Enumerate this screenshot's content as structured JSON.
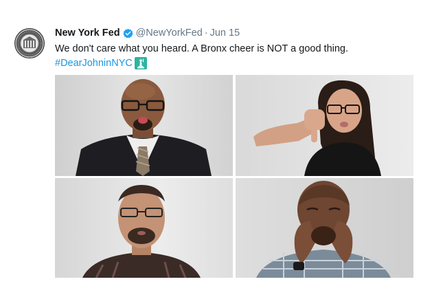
{
  "tweet": {
    "display_name": "New York Fed",
    "handle": "@NewYorkFed",
    "separator": "·",
    "date": "Jun 15",
    "text": "We don't care what you heard. A Bronx cheer is NOT a good thing.",
    "hashtag": "#DearJohninNYC",
    "hashtag_emoji": "statue-of-liberty-emoji",
    "avatar": "federal-reserve-seal-icon",
    "verified": "verified-badge-icon"
  },
  "media": {
    "photos": [
      {
        "alt": "man in suit and glasses sticking out tongue"
      },
      {
        "alt": "woman giving thumbs down"
      },
      {
        "alt": "man with glasses puffing cheeks"
      },
      {
        "alt": "man cupping hands around mouth"
      }
    ]
  },
  "colors": {
    "link": "#1b95e0",
    "secondary_text": "#657786",
    "primary_text": "#14171a",
    "verified_badge": "#1da1f2"
  }
}
